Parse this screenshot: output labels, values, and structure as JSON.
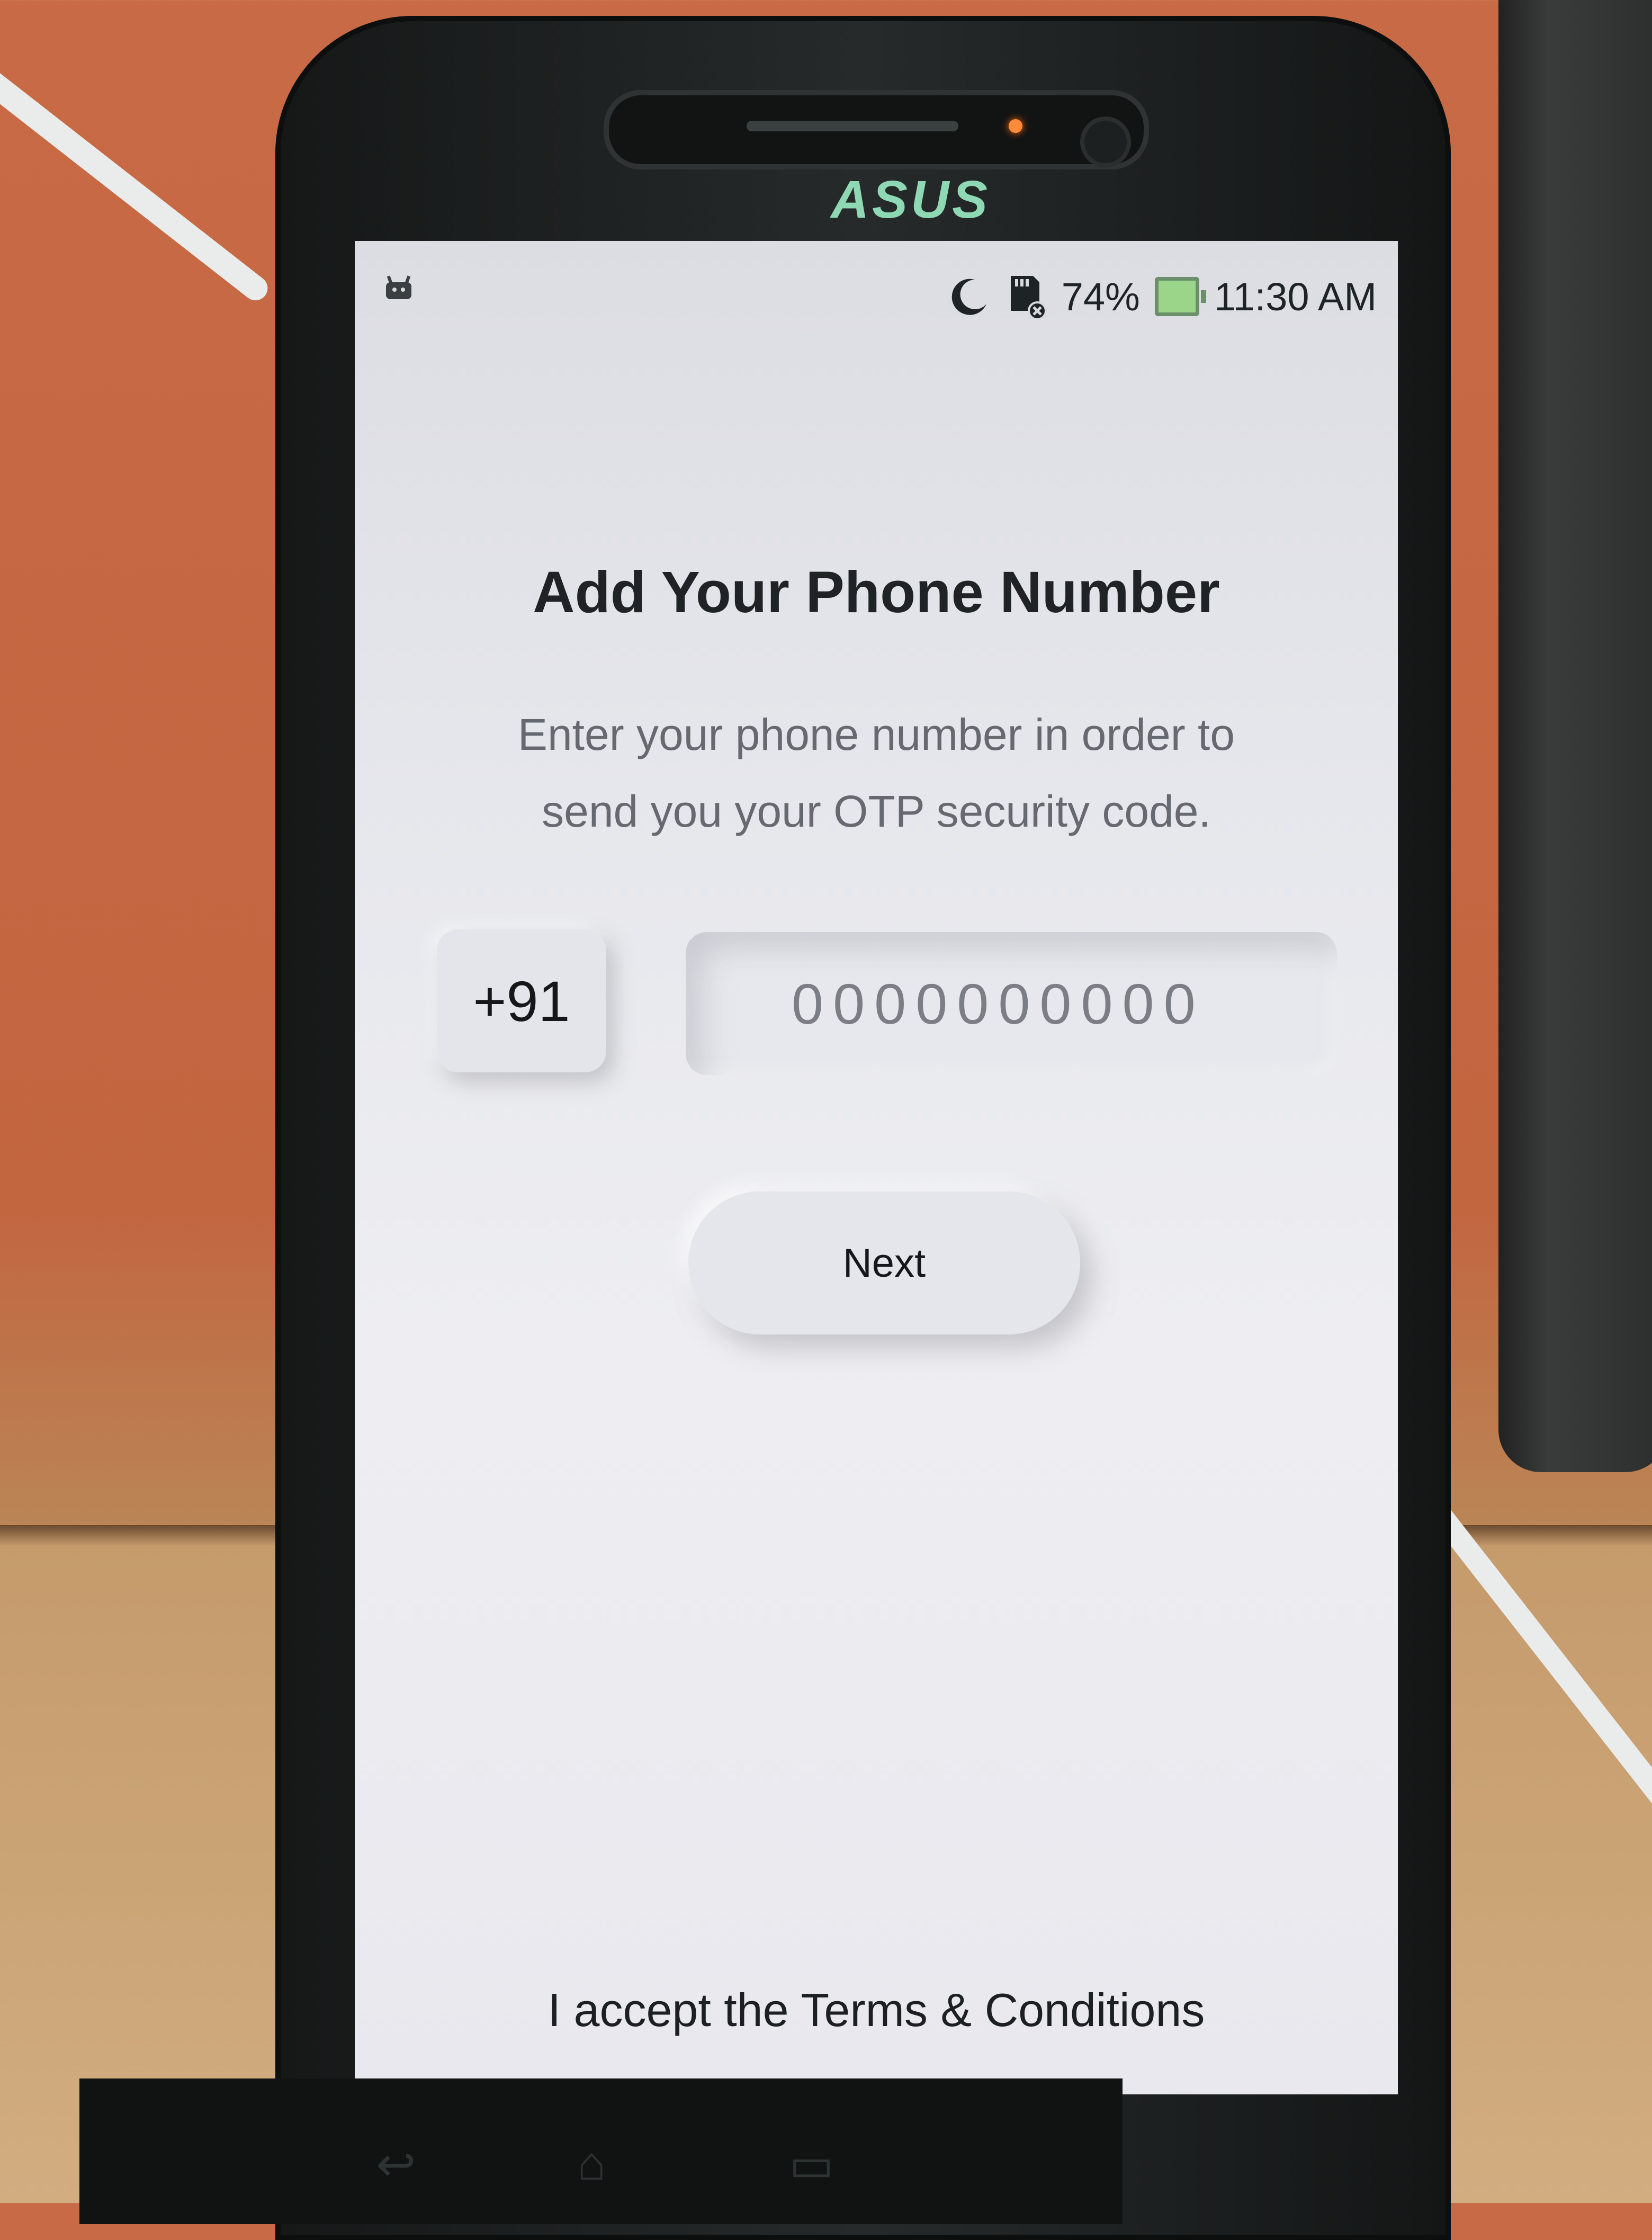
{
  "device": {
    "brand": "ASUS"
  },
  "statusbar": {
    "battery_percent": "74%",
    "time": "11:30 AM",
    "icons": [
      "android-debug-icon",
      "moon-icon",
      "sd-card-icon",
      "battery-charging-icon"
    ]
  },
  "screen": {
    "title": "Add Your Phone Number",
    "subtitle": "Enter your phone number in order to send you your OTP security code.",
    "country_code": "+91",
    "phone_placeholder": "0000000000",
    "next_label": "Next",
    "terms_text": "I accept the Terms & Conditions"
  },
  "colors": {
    "screen_bg": "#e6e7ec",
    "title": "#202326",
    "subtitle": "#666a70",
    "placeholder": "#7b7e85"
  }
}
